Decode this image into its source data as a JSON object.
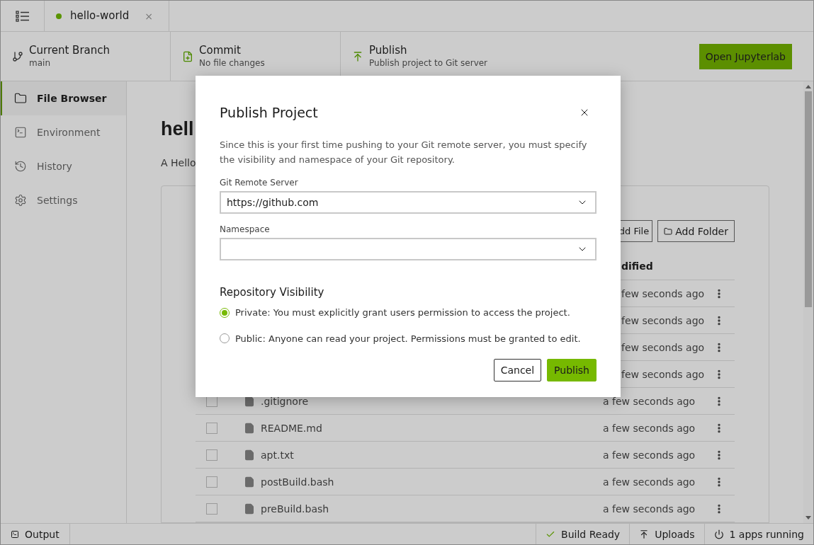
{
  "tab": {
    "label": "hello-world",
    "selected": true,
    "color": "#5a9400",
    "close": "×"
  },
  "toolbar": {
    "sections": [
      {
        "title": "Current Branch",
        "subtitle": "main"
      },
      {
        "title": "Commit",
        "subtitle": "No file changes"
      },
      {
        "title": "Publish",
        "subtitle": "Publish project to Git server"
      }
    ],
    "open_button": "Open Jupyterlab"
  },
  "sidebar": {
    "items": [
      {
        "label": "File Browser",
        "selected": true
      },
      {
        "label": "Environment",
        "selected": false
      },
      {
        "label": "History",
        "selected": false
      },
      {
        "label": "Settings",
        "selected": false
      }
    ]
  },
  "content": {
    "title": "hell",
    "description": "A Hello",
    "buttons": [
      "dd File",
      "Add Folder"
    ],
    "column_header": "dified",
    "rows": [
      {
        "modified": "few seconds ago"
      },
      {
        "modified": "few seconds ago"
      },
      {
        "modified": "few seconds ago"
      },
      {
        "modified": "few seconds ago"
      },
      {
        "name": ".gitignore",
        "modified": "a few seconds ago",
        "checked": false
      },
      {
        "name": "README.md",
        "modified": "a few seconds ago",
        "checked": false
      },
      {
        "name": "apt.txt",
        "modified": "a few seconds ago",
        "checked": false
      },
      {
        "name": "postBuild.bash",
        "modified": "a few seconds ago",
        "checked": false
      },
      {
        "name": "preBuild.bash",
        "modified": "a few seconds ago",
        "checked": false
      }
    ]
  },
  "dialog": {
    "title": "Publish Project",
    "description": "Since this is your first time pushing to your Git remote server, you must specify the visibility and namespace of your Git repository.",
    "fields": [
      {
        "label": "Git Remote Server",
        "value": "https://github.com"
      },
      {
        "label": "Namespace"
      }
    ],
    "visibility_title": "Repository Visibility",
    "options": [
      {
        "label": "Private: You must explicitly grant users permission to access the project.",
        "selected": true
      },
      {
        "label": "Public: Anyone can read your project. Permissions must be granted to edit.",
        "selected": false
      }
    ],
    "buttons": [
      {
        "label": "Cancel",
        "kind": "secondary"
      },
      {
        "label": "Publish",
        "kind": "primary"
      }
    ]
  },
  "status_bar": {
    "left": "Output",
    "items": [
      {
        "label": "Build Ready"
      },
      {
        "label": "Uploads"
      },
      {
        "label": "1 apps running"
      }
    ]
  }
}
